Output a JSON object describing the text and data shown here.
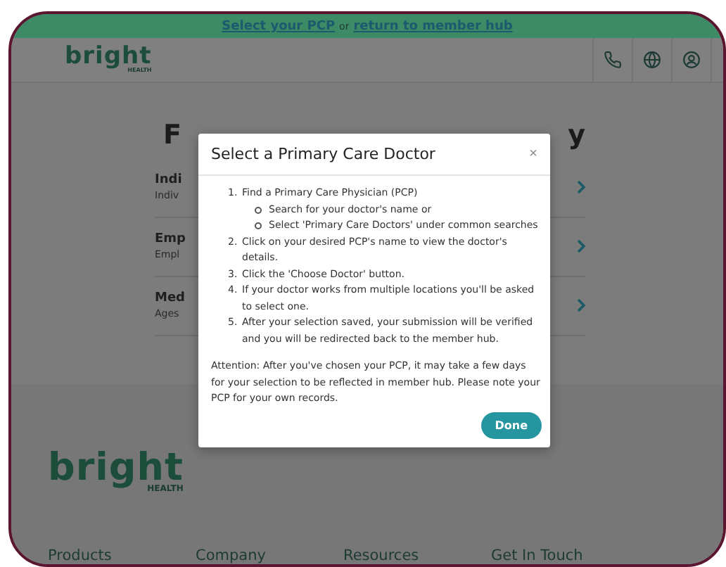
{
  "banner": [
    {
      "kind": "link",
      "text": "Select your PCP"
    },
    {
      "kind": "text",
      "text": "or"
    },
    {
      "kind": "link",
      "text": "return to member hub"
    }
  ],
  "header": {
    "logo": {
      "word": "bright",
      "sub": "HEALTH"
    }
  },
  "main": {
    "heading_fragments": [
      "F",
      "y"
    ],
    "rows": [
      {
        "title": "Indi",
        "subtitle": "Indiv"
      },
      {
        "title": "Emp",
        "subtitle": "Empl"
      },
      {
        "title": "Med",
        "subtitle": "Ages"
      }
    ]
  },
  "modal": {
    "title": "Select a Primary Care Doctor",
    "close": "×",
    "steps": [
      {
        "number": "1.",
        "text": "Find a Primary Care Physician (PCP)",
        "children": [
          {
            "text": "Search for your doctor's name or"
          },
          {
            "text": "Select 'Primary Care Doctors' under common searches"
          }
        ]
      },
      {
        "number": "2.",
        "text": "Click on your desired PCP's name to view the doctor's details."
      },
      {
        "number": "3.",
        "text": "Click the 'Choose Doctor' button."
      },
      {
        "number": "4.",
        "text": "If your doctor works from multiple locations you'll be asked to select one."
      },
      {
        "number": "5.",
        "text": "After your selection saved, your submission will be verified and you will be redirected back to the member hub."
      }
    ],
    "note": "Attention: After you've chosen your PCP, it may take a few days for your selection to be reflected in member hub. Please note your PCP for your own records.",
    "button": "Done"
  },
  "footer": {
    "logo": {
      "word": "bright",
      "sub": "HEALTH"
    },
    "nav": [
      "Products",
      "Company",
      "Resources",
      "Get In Touch"
    ]
  }
}
